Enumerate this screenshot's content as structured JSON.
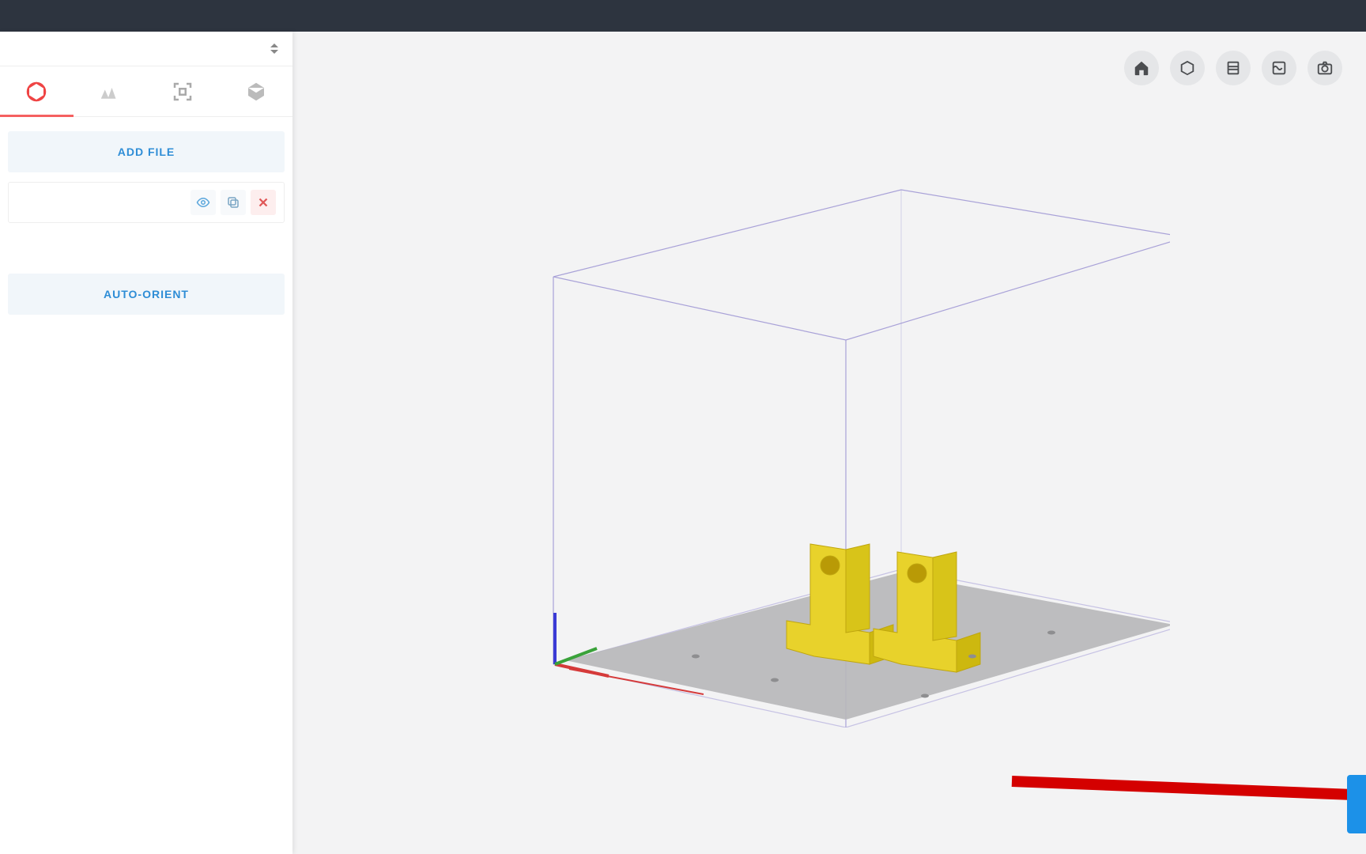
{
  "app": {
    "title": ""
  },
  "sidebar": {
    "printer": {
      "name": ""
    },
    "tabs": [
      {
        "name": "models",
        "icon": "circle-icon",
        "active": true
      },
      {
        "name": "supports",
        "icon": "supports-icon",
        "active": false
      },
      {
        "name": "layout",
        "icon": "layout-icon",
        "active": false
      },
      {
        "name": "printer",
        "icon": "printer-icon",
        "active": false
      }
    ],
    "add_file_label": "ADD FILE",
    "auto_orient_label": "AUTO-ORIENT",
    "files": [
      {
        "name": "",
        "visible": true
      }
    ]
  },
  "viewport": {
    "buttons": [
      {
        "name": "home",
        "icon": "home"
      },
      {
        "name": "perspective",
        "icon": "cube"
      },
      {
        "name": "slice",
        "icon": "layers"
      },
      {
        "name": "material",
        "icon": "wave"
      },
      {
        "name": "camera",
        "icon": "camera"
      }
    ],
    "colors": {
      "build_box": "#a9a2d8",
      "plate": "#b7b7b9",
      "model": "#e8d22b",
      "axis_x": "#d53a3a",
      "axis_y": "#3aa23a",
      "axis_z": "#3a3ad5"
    }
  },
  "annotation": {
    "arrow_color": "#d40000"
  },
  "footer": {
    "upload_label": ""
  }
}
